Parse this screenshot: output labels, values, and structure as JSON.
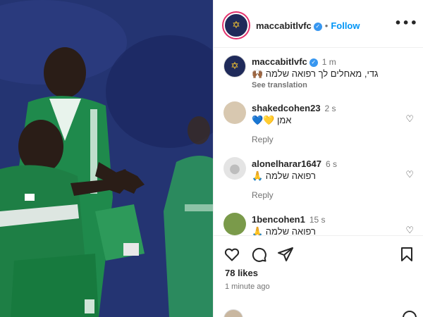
{
  "post": {
    "username": "maccabitlvfc",
    "follow_label": "Follow",
    "more_label": "•••"
  },
  "caption": {
    "username": "maccabitlvfc",
    "time": "1 m",
    "text": "גדי, מאחלים לך רפואה שלמה 🙌🏾",
    "see_translation": "See translation"
  },
  "comments": [
    {
      "username": "shakedcohen23",
      "time": "2 s",
      "text": "אמן 💛💙",
      "reply_label": "Reply"
    },
    {
      "username": "alonelharar1647",
      "time": "6 s",
      "text": "רפואה שלמה 🙏",
      "reply_label": "Reply"
    },
    {
      "username": "1bencohen1",
      "time": "15 s",
      "text": "רפואה שלמה 🙏"
    }
  ],
  "actions": {
    "like_icon": "heart-icon",
    "comment_icon": "comment-icon",
    "share_icon": "share-icon",
    "save_icon": "bookmark-icon"
  },
  "likes_text": "78 likes",
  "posted_time": "1 minute ago",
  "colors": {
    "accent": "#0095f6",
    "verified": "#3897f0",
    "jersey": "#1f8a4c",
    "background": "#ffffff"
  }
}
